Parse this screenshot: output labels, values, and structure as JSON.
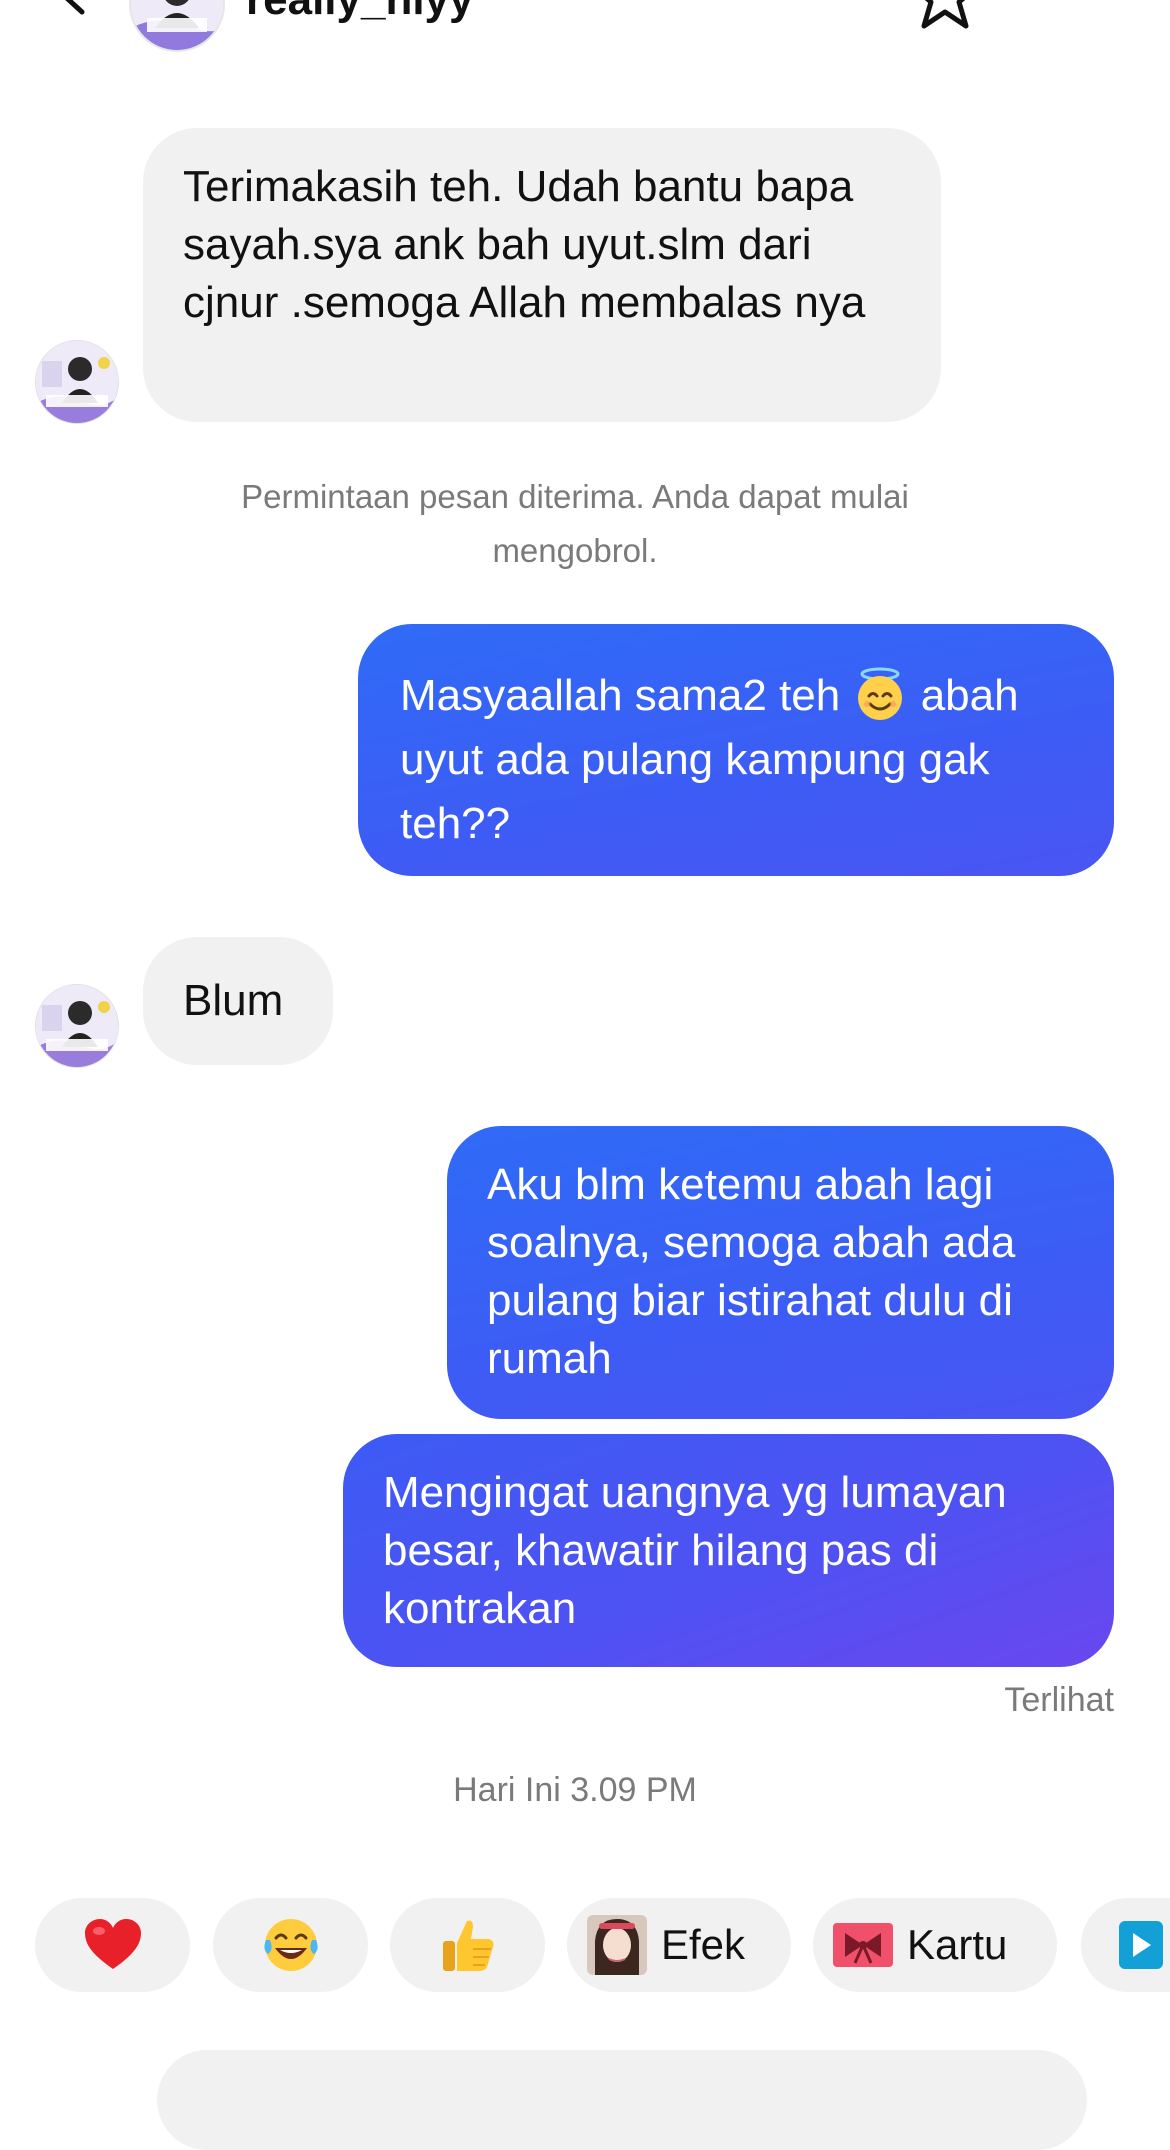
{
  "header": {
    "username": "really_nlyy"
  },
  "messages": [
    {
      "side": "incoming",
      "text": "Terimakasih teh. Udah bantu bapa sayah.sya ank bah uyut.slm dari cjnur .semoga Allah membalas nya"
    },
    {
      "side": "system",
      "text": "Permintaan pesan diterima. Anda dapat mulai mengobrol."
    },
    {
      "side": "outgoing",
      "text_before_emoji": "Masyaallah sama2 teh ",
      "emoji": "smiling-face-with-halo",
      "text_after_emoji": " abah uyut ada pulang kampung gak teh??"
    },
    {
      "side": "incoming",
      "text": "Blum"
    },
    {
      "side": "outgoing",
      "text": "Aku blm ketemu abah lagi soalnya, semoga abah ada pulang biar istirahat dulu di rumah"
    },
    {
      "side": "outgoing",
      "text": "Mengingat uangnya yg lumayan besar, khawatir hilang pas di kontrakan"
    }
  ],
  "status": {
    "seen": "Terlihat",
    "timestamp": "Hari Ini 3.09 PM"
  },
  "quick_actions": [
    {
      "icon": "red-heart-emoji"
    },
    {
      "icon": "tears-of-joy-emoji"
    },
    {
      "icon": "thumbs-up-emoji"
    },
    {
      "icon": "effect-thumbnail",
      "label": "Efek"
    },
    {
      "icon": "ribbon-card-icon",
      "label": "Kartu"
    },
    {
      "icon": "play-icon"
    }
  ],
  "colors": {
    "outgoing_bubble_start": "#2f6bf6",
    "outgoing_bubble_end": "#6a47ef",
    "incoming_bubble": "#f1f1f1",
    "muted_text": "#7a7a7a"
  }
}
